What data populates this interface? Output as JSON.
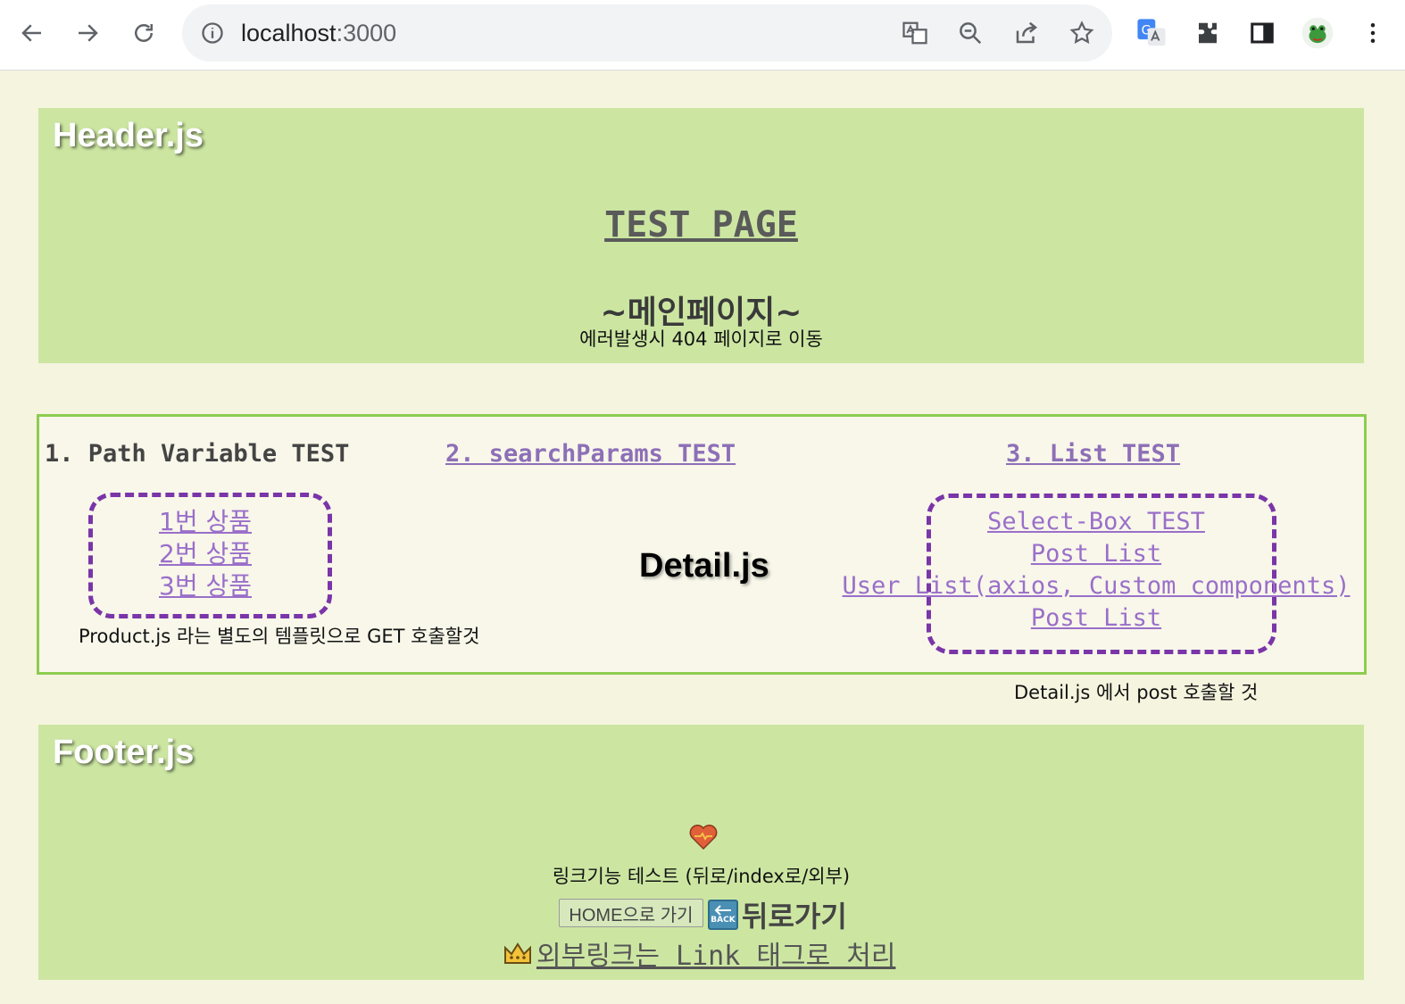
{
  "browser": {
    "url_host": "localhost",
    "url_port": ":3000"
  },
  "header": {
    "tag": "Header.js",
    "test_page_link": "TEST PAGE",
    "main_title": "~메인페이지~",
    "error_note": "에러발생시 404 페이지로 이동"
  },
  "main": {
    "nav": {
      "path_variable": "1. Path Variable TEST",
      "search_params": "2. searchParams TEST",
      "list_test": "3. List TEST"
    },
    "products": [
      "1번 상품",
      "2번 상품",
      "3번 상품"
    ],
    "product_note": "Product.js 라는 별도의 템플릿으로 GET 호출할것",
    "detail_label": "Detail.js",
    "list_links": [
      "Select-Box TEST",
      "Post List",
      "User List(axios, Custom components)",
      "Post List"
    ],
    "detail_note": "Detail.js 에서 post 호출할 것"
  },
  "footer": {
    "tag": "Footer.js",
    "link_test": "링크기능 테스트 (뒤로/index로/외부)",
    "home_button": "HOME으로 가기",
    "back_icon_text": "BACK",
    "back_link": "뒤로가기",
    "external_link": "외부링크는 Link 태그로 처리"
  },
  "colors": {
    "section_green": "#cce6a2",
    "main_border": "#8dcc50",
    "dash_purple": "#7a35a8",
    "link_purple": "#9a6fc9",
    "page_bg": "#f5f4df"
  }
}
